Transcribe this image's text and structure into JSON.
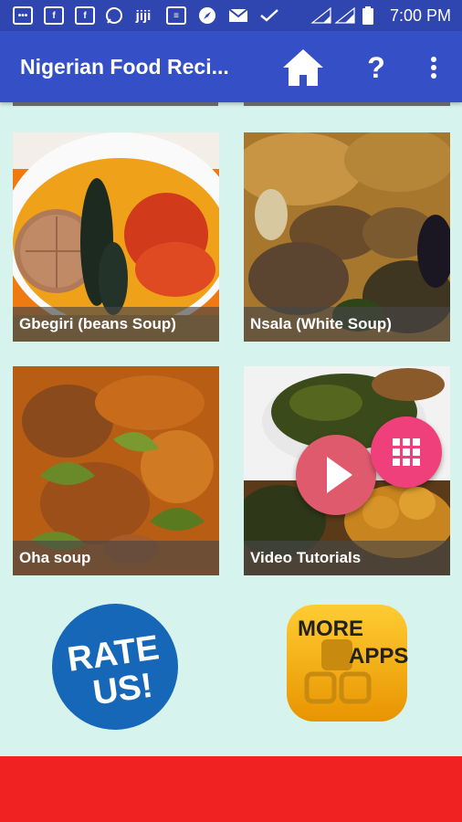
{
  "status_bar": {
    "time": "7:00 PM",
    "left_icons": [
      "message-icon",
      "facebook-icon",
      "facebook-icon",
      "whatsapp-icon",
      "jiji-icon",
      "chat-icon",
      "compass-icon",
      "mail-icon",
      "check-icon"
    ],
    "right_icons": [
      "signal-icon",
      "signal-icon",
      "battery-icon"
    ]
  },
  "app_bar": {
    "title": "Nigerian Food Reci...",
    "help_label": "?"
  },
  "tiles": [
    {
      "label": "Gbegiri (beans Soup)"
    },
    {
      "label": "Nsala (White Soup)"
    },
    {
      "label": "Oha soup"
    },
    {
      "label": "Video Tutorials"
    }
  ],
  "rate_us": {
    "line1": "RATE",
    "line2": "US!"
  },
  "more_apps": {
    "line1": "MORE",
    "line2": "APPS"
  },
  "colors": {
    "status_bar": "#2f45b0",
    "app_bar": "#3550c6",
    "background": "#d7f3ee",
    "play_fab": "#e05a6e",
    "grid_fab": "#f0407c",
    "bottom_bar": "#f02222",
    "rate_blue": "#1667b8",
    "more_orange": "#f2a500"
  }
}
